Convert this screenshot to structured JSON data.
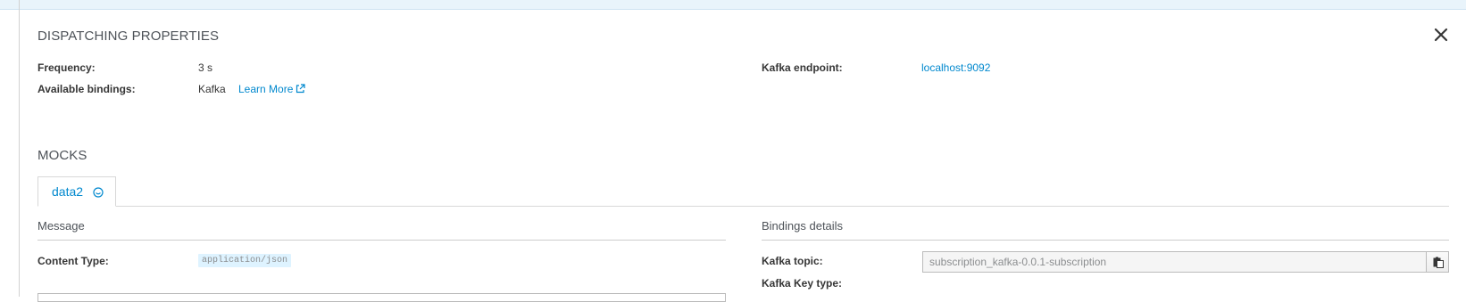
{
  "dispatching": {
    "title": "DISPATCHING PROPERTIES",
    "frequency_label": "Frequency:",
    "frequency_value": "3 s",
    "bindings_label": "Available bindings:",
    "bindings_value": "Kafka",
    "learn_more": "Learn More",
    "kafka_endpoint_label": "Kafka endpoint:",
    "kafka_endpoint_value": "localhost:9092"
  },
  "mocks": {
    "title": "MOCKS",
    "tabs": [
      {
        "label": "data2",
        "icon": "circle-smile-icon"
      }
    ],
    "message": {
      "title": "Message",
      "content_type_label": "Content Type:",
      "content_type_value": "application/json"
    },
    "bindings_details": {
      "title": "Bindings details",
      "kafka_topic_label": "Kafka topic:",
      "kafka_topic_value": "subscription_kafka-0.0.1-subscription",
      "kafka_key_type_label": "Kafka Key type:"
    }
  },
  "icons": {
    "close": "close-icon",
    "external_link": "external-link-icon",
    "copy": "clipboard-icon"
  },
  "colors": {
    "link": "#0088ce",
    "top_strip": "#e9f4fb",
    "badge_bg": "#def3ff"
  }
}
